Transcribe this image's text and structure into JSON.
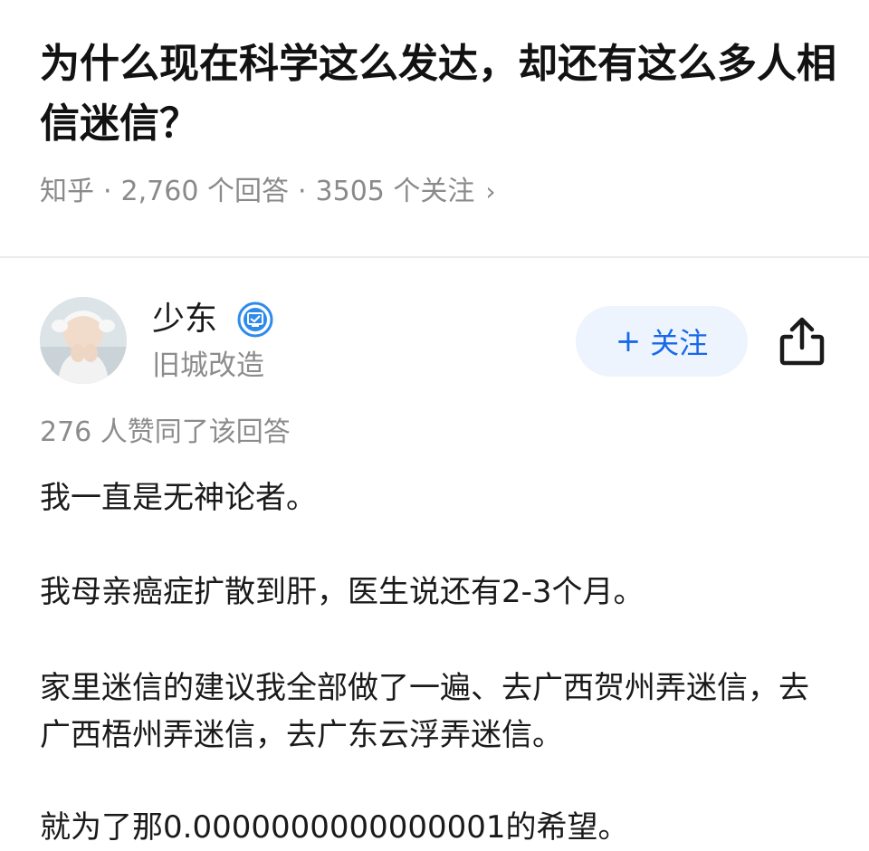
{
  "question": {
    "title": "为什么现在科学这么发达，却还有这么多人相信迷信？",
    "source": "知乎",
    "answers_count": "2,760 个回答",
    "followers_count": "3505 个关注",
    "separator": "·",
    "chevron": "›"
  },
  "author": {
    "name": "少东",
    "bio": "旧城改造",
    "verified_badge_icon": "verified-badge-icon",
    "follow_plus": "+",
    "follow_label": "关注"
  },
  "answer": {
    "likes_text": "276 人赞同了该回答",
    "paragraphs": [
      "我一直是无神论者。",
      "我母亲癌症扩散到肝，医生说还有2-3个月。",
      "家里迷信的建议我全部做了一遍、去广西贺州弄迷信，去广西梧州弄迷信，去广东云浮弄迷信。",
      "就为了那0.0000000000000001的希望。"
    ]
  },
  "colors": {
    "accent": "#1769ea",
    "follow_bg": "#eef4fd",
    "muted_text": "#8c8c8c",
    "text": "#1a1a1a"
  }
}
